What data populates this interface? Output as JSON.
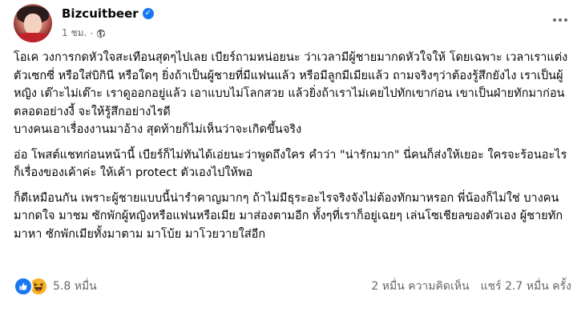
{
  "post": {
    "page_name": "Bizcuitbeer",
    "time": "1 ชม.",
    "separator": "·",
    "paragraphs": [
      "โอเค วงการกดหัวใจสะเทือนสุดๆไปเลย เบียร์ถามหน่อยนะ ว่าเวลามีผู้ชายมากดหัวใจให้ โดยเฉพาะ เวลาเราแต่งตัวเซกซี่ หรือใส่บิกินี หรือใดๆ ยิ่งถ้าเป็นผู้ชายที่มีแฟนแล้ว หรือมีลูกมีเมียแล้ว ถามจริงๆว่าต้องรู้สึกยังไง เราเป็นผู้หญิง เต๊าะไม่เต๊าะ เราดูออกอยู่แล้ว เอาแบบไม่โลกสวย แล้วยิ่งถ้าเราไม่เคยไปทักเขาก่อน เขาเป็นฝ่ายทักมาก่อนตลอดอย่างงี้ จะให้รู้สึกอย่างไรดี\nบางคนเอาเรื่องงานมาอ้าง สุดท้ายก็ไม่เห็นว่าจะเกิดขึ้นจริง",
      "อ่อ โพสต์แชทก่อนหน้านี้ เบียร์ก็ไม่ทันได้เอ่ยนะว่าพูดถึงใคร คำว่า \"น่ารักมาก\" นี่คนก็ส่งให้เยอะ ใครจะร้อนอะไรก็เรื่องของเค้าค่ะ ให้เค้า protect ตัวเองไปให้พอ",
      "ก็ดีเหมือนกัน เพราะผู้ชายแบบนี้น่ารำคาญมากๆ ถ้าไม่มีธุระอะไรจริงจังไม่ต้องทักมาหรอก พี่น้องก็ไม่ใช่ บางคนมากดใจ มาชม ซักพักผู้หญิงหรือแฟนหรือเมีย มาส่องตามอีก ทั้งๆที่เราก็อยู่เฉยๆ เล่นโซเชียลของตัวเอง ผู้ชายทักมาหา ซักพักเมียทั้งมาตาม มาโบ้ย มาโวยวายใส่อีก"
    ],
    "reactions_count": "5.8 หมื่น",
    "comments_count": "2 หมื่น ความคิดเห็น",
    "shares_count": "แชร์ 2.7 หมื่น ครั้ง"
  },
  "colors": {
    "text": "#050505",
    "meta": "#65676b",
    "like": "#1877f2",
    "haha": "#f7b125"
  },
  "icons": {
    "verified": "verified-badge-icon",
    "privacy": "globe-icon",
    "more": "more-options-icon",
    "like": "like-reaction-icon",
    "haha": "haha-reaction-icon"
  }
}
